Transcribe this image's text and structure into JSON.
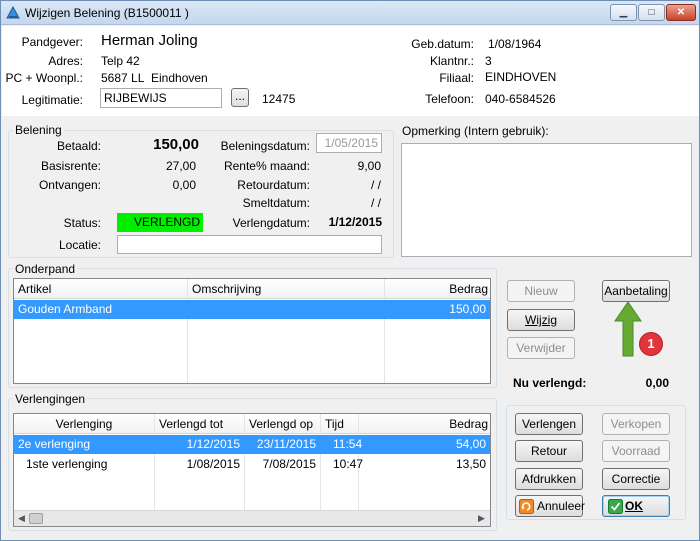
{
  "window": {
    "title": "Wijzigen Belening  (B1500011  )",
    "minimize_glyph": "▁",
    "maximize_glyph": "□",
    "close_glyph": "✕"
  },
  "header": {
    "pandgever_label": "Pandgever:",
    "pandgever_value": "Herman Joling",
    "adres_label": "Adres:",
    "adres_value": "Telp 42",
    "pc_label": "PC + Woonpl.:",
    "pc_value": "5687 LL",
    "woonplaats_value": "Eindhoven",
    "legitimatie_label": "Legitimatie:",
    "legitimatie_value": "RIJBEWIJS",
    "browse_label": "...",
    "legitimatie_nr": "12475",
    "gebdatum_label": "Geb.datum:",
    "gebdatum_value": "1/08/1964",
    "klantnr_label": "Klantnr.:",
    "klantnr_value": "3",
    "filiaal_label": "Filiaal:",
    "filiaal_value": "EINDHOVEN",
    "telefoon_label": "Telefoon:",
    "telefoon_value": "040-6584526"
  },
  "belening": {
    "group_title": "Belening",
    "betaald_label": "Betaald:",
    "betaald_value": "150,00",
    "basisrente_label": "Basisrente:",
    "basisrente_value": "27,00",
    "ontvangen_label": "Ontvangen:",
    "ontvangen_value": "0,00",
    "beleningsdatum_label": "Beleningsdatum:",
    "beleningsdatum_value": "1/05/2015",
    "rente_label": "Rente% maand:",
    "rente_value": "9,00",
    "retourdatum_label": "Retourdatum:",
    "retourdatum_value": "/ /",
    "smeltdatum_label": "Smeltdatum:",
    "smeltdatum_value": "/ /",
    "status_label": "Status:",
    "status_value": "VERLENGD",
    "status_color": "#00ee00",
    "verlengdatum_label": "Verlengdatum:",
    "verlengdatum_value": "1/12/2015",
    "locatie_label": "Locatie:",
    "locatie_value": ""
  },
  "opmerking": {
    "title": "Opmerking (Intern gebruik):",
    "value": ""
  },
  "onderpand": {
    "group_title": "Onderpand",
    "columns": [
      "Artikel",
      "Omschrijving",
      "Bedrag"
    ],
    "rows": [
      {
        "artikel": "Gouden Armband",
        "omschrijving": "",
        "bedrag": "150,00"
      }
    ],
    "buttons": {
      "nieuw": "Nieuw",
      "wijzig": "Wijzig",
      "verwijder": "Verwijder",
      "aanbetaling": "Aanbetaling"
    },
    "annotation_number": "1",
    "annotation_color": "#e0353a",
    "arrow_color": "#66aa33"
  },
  "nu_verlengd": {
    "label": "Nu verlengd:",
    "value": "0,00"
  },
  "verlengingen": {
    "group_title": "Verlengingen",
    "columns": [
      "Verlenging",
      "Verlengd tot",
      "Verlengd op",
      "Tijd",
      "Bedrag"
    ],
    "rows": [
      {
        "verlenging": "2e verlenging",
        "tot": "1/12/2015",
        "op": "23/11/2015",
        "tijd": "11:54",
        "bedrag": "54,00"
      },
      {
        "verlenging": "1ste verlenging",
        "tot": "1/08/2015",
        "op": "7/08/2015",
        "tijd": "10:47",
        "bedrag": "13,50"
      }
    ]
  },
  "actions": {
    "verlengen": "Verlengen",
    "verkopen": "Verkopen",
    "retour": "Retour",
    "voorraad": "Voorraad",
    "afdrukken": "Afdrukken",
    "correctie": "Correctie",
    "annuleer": "Annuleer",
    "ok": "OK"
  }
}
